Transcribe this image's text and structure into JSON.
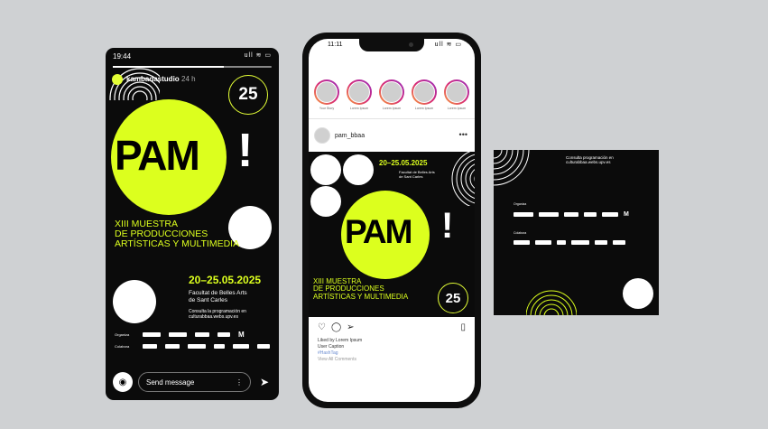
{
  "story": {
    "time": "19:44",
    "status_icons": "ull ≋ ▭",
    "account": "kambadastudio",
    "age": "24 h",
    "badge": "25",
    "title": "PAM",
    "bang": "!",
    "muestra": [
      "XIII MUESTRA",
      "DE PRODUCCIONES",
      "ARTÍSTICAS Y MULTIMEDIA"
    ],
    "dates": "20–25.05.2025",
    "faculty": [
      "Facultat de Belles Arts",
      "de Sant Carles"
    ],
    "consult": [
      "Consulta la programación en",
      "culturabbaa.webs.upv.es"
    ],
    "organiza": "Organiza",
    "colabora": "Colabora",
    "send_placeholder": "Send message"
  },
  "feed": {
    "time": "11:11",
    "status_icons": "ull ≋ ▭",
    "story_names": [
      "Your Story",
      "Lorem Ipsum",
      "Lorem Ipsum",
      "Lorem Ipsum",
      "Lorem Ipsum"
    ],
    "username": "pam_bbaa",
    "more": "•••",
    "post": {
      "dates": "20–25.05.2025",
      "faculty": [
        "Facultat de Belles Arts",
        "de Sant Carles"
      ],
      "title": "PAM",
      "bang": "!",
      "muestra": [
        "XIII MUESTRA",
        "DE PRODUCCIONES",
        "ARTÍSTICAS Y MULTIMEDIA"
      ],
      "badge": "25"
    },
    "likes": "Liked by Lorem Ipsum",
    "caption": "User Caption",
    "hashtag": "#HashTag",
    "comments": "View All Comments"
  },
  "square": {
    "consult": "Consulta programación en culturabbaa.webs.upv.es",
    "organiza": "Organiza",
    "colabora": "Colabora"
  },
  "colors": {
    "lime": "#dcff1e",
    "black": "#0b0b0b",
    "bg": "#cfd1d3"
  }
}
